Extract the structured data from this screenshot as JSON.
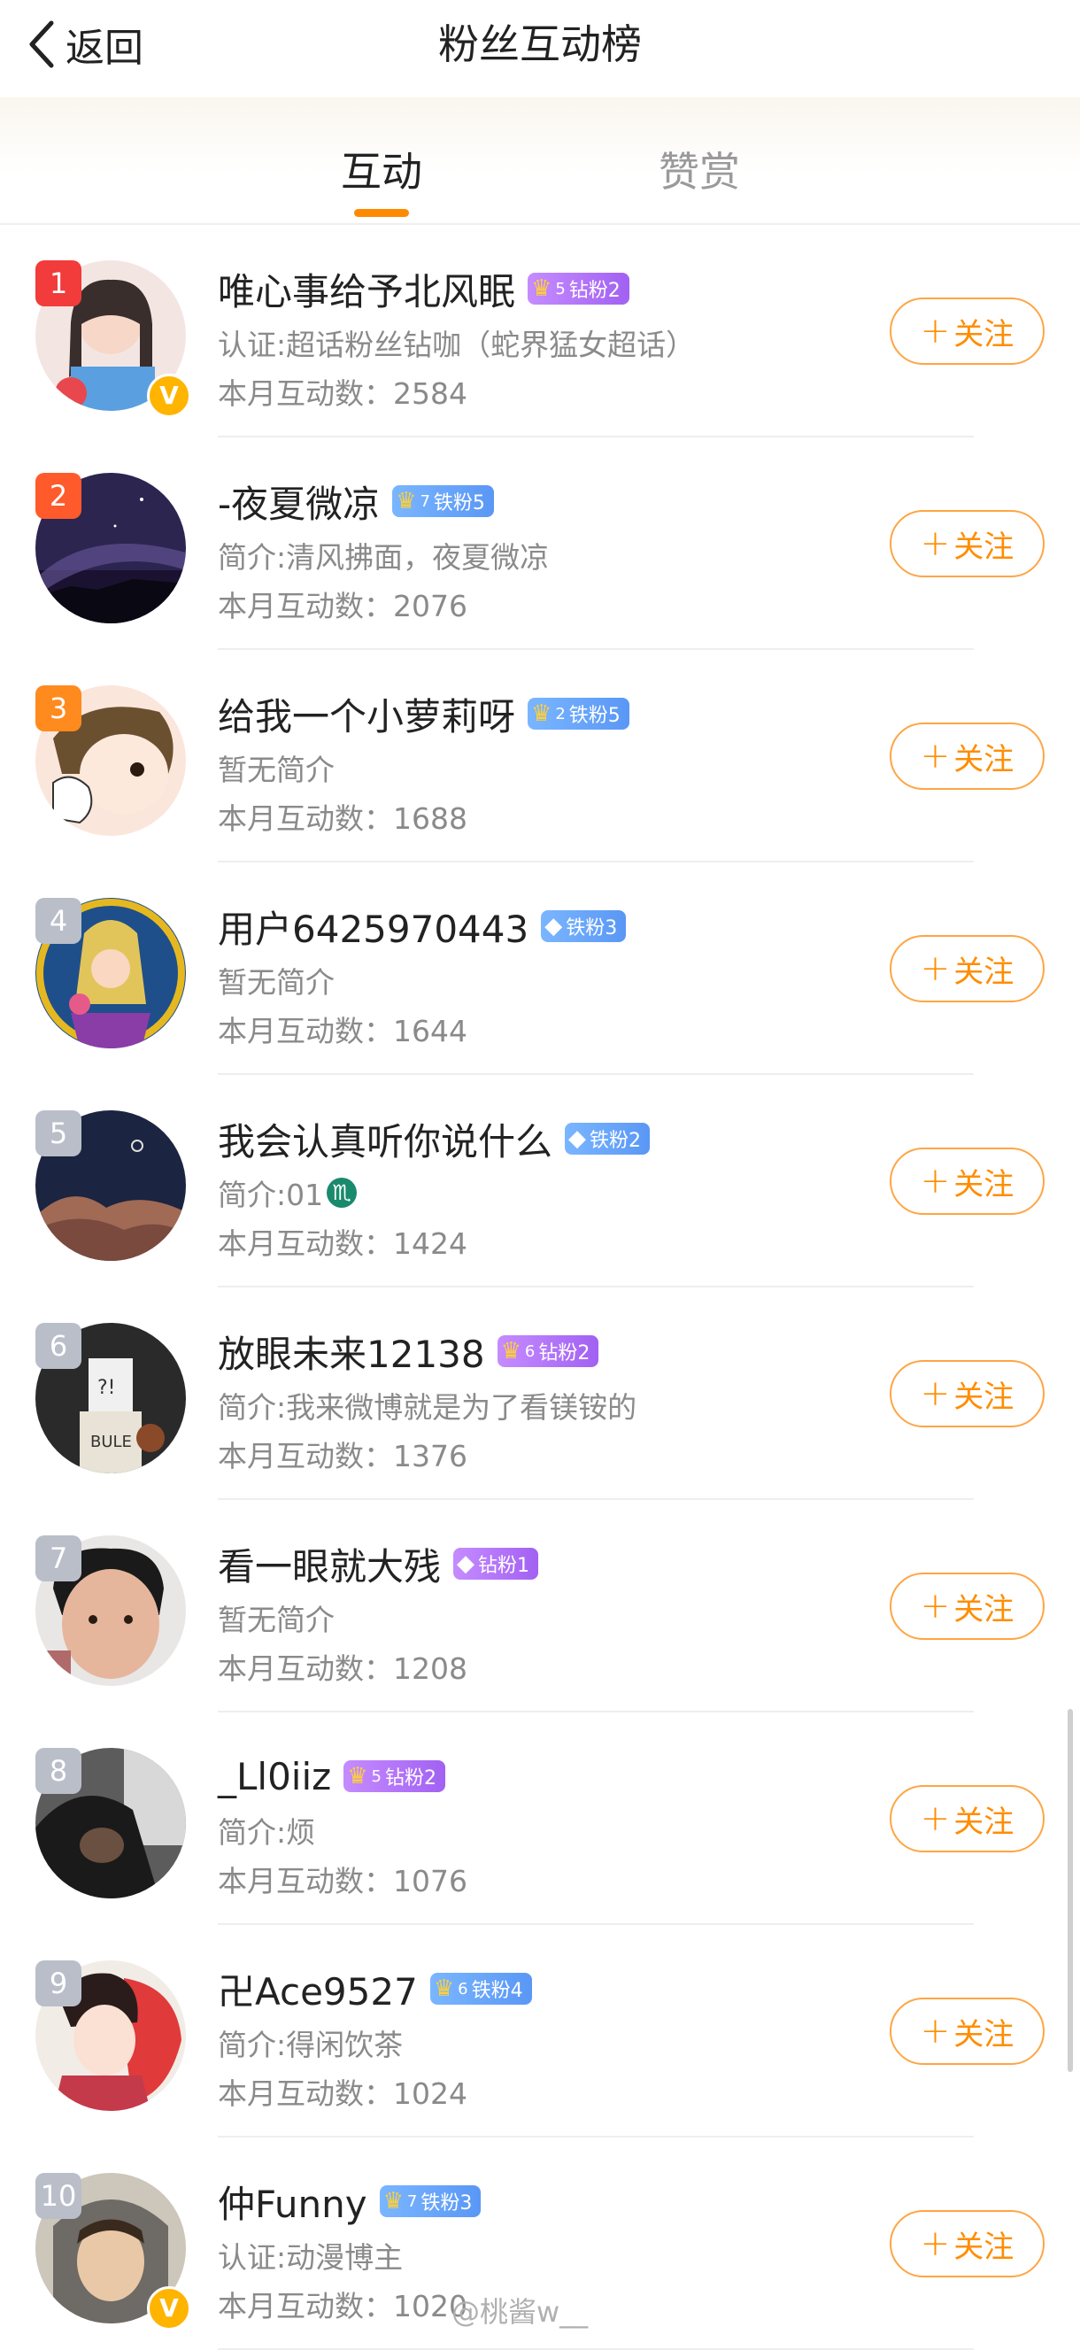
{
  "nav": {
    "back_label": "返回",
    "title": "粉丝互动榜"
  },
  "tabs": [
    {
      "label": "互动",
      "active": true
    },
    {
      "label": "赞赏",
      "active": false
    }
  ],
  "follow_label": "关注",
  "follow_icon": "plus-icon",
  "accent_color": "#ff8d00",
  "watermark": "@桃酱w__",
  "fans": [
    {
      "rank": "1",
      "name": "唯心事给予北风眠",
      "badge": {
        "level": "5",
        "label": "钻粉2",
        "style": "purple"
      },
      "bio": "认证:超话粉丝钻咖（蛇界猛女超话）",
      "count_label": "本月互动数：",
      "count": "2584",
      "verified": true
    },
    {
      "rank": "2",
      "name": "-夜夏微凉",
      "badge": {
        "level": "7",
        "label": "铁粉5",
        "style": "blue"
      },
      "bio": "简介:清风拂面，夜夏微凉",
      "count_label": "本月互动数：",
      "count": "2076",
      "verified": false
    },
    {
      "rank": "3",
      "name": "给我一个小萝莉呀",
      "badge": {
        "level": "2",
        "label": "铁粉5",
        "style": "blue"
      },
      "bio": "暂无简介",
      "count_label": "本月互动数：",
      "count": "1688",
      "verified": false
    },
    {
      "rank": "4",
      "name": "用户6425970443",
      "badge": {
        "level": "",
        "label": "铁粉3",
        "style": "blue"
      },
      "bio": "暂无简介",
      "count_label": "本月互动数：",
      "count": "1644",
      "verified": false
    },
    {
      "rank": "5",
      "name": "我会认真听你说什么",
      "badge": {
        "level": "",
        "label": "铁粉2",
        "style": "blue"
      },
      "bio": "简介:01",
      "bio_icon": "♏",
      "count_label": "本月互动数：",
      "count": "1424",
      "verified": false
    },
    {
      "rank": "6",
      "name": "放眼未来12138",
      "badge": {
        "level": "6",
        "label": "钻粉2",
        "style": "purple"
      },
      "bio": "简介:我来微博就是为了看镁铵的",
      "count_label": "本月互动数：",
      "count": "1376",
      "verified": false
    },
    {
      "rank": "7",
      "name": "看一眼就大残",
      "badge": {
        "level": "",
        "label": "钻粉1",
        "style": "purple"
      },
      "bio": "暂无简介",
      "count_label": "本月互动数：",
      "count": "1208",
      "verified": false
    },
    {
      "rank": "8",
      "name": "_Ll0iiz",
      "badge": {
        "level": "5",
        "label": "钻粉2",
        "style": "purple"
      },
      "bio": "简介:烦",
      "count_label": "本月互动数：",
      "count": "1076",
      "verified": false
    },
    {
      "rank": "9",
      "name": "卍Ace9527",
      "badge": {
        "level": "6",
        "label": "铁粉4",
        "style": "blue"
      },
      "bio": "简介:得闲饮茶",
      "count_label": "本月互动数：",
      "count": "1024",
      "verified": false
    },
    {
      "rank": "10",
      "name": "仲Funny",
      "badge": {
        "level": "7",
        "label": "铁粉3",
        "style": "blue"
      },
      "bio": "认证:动漫博主",
      "count_label": "本月互动数：",
      "count": "1020",
      "verified": true
    }
  ]
}
